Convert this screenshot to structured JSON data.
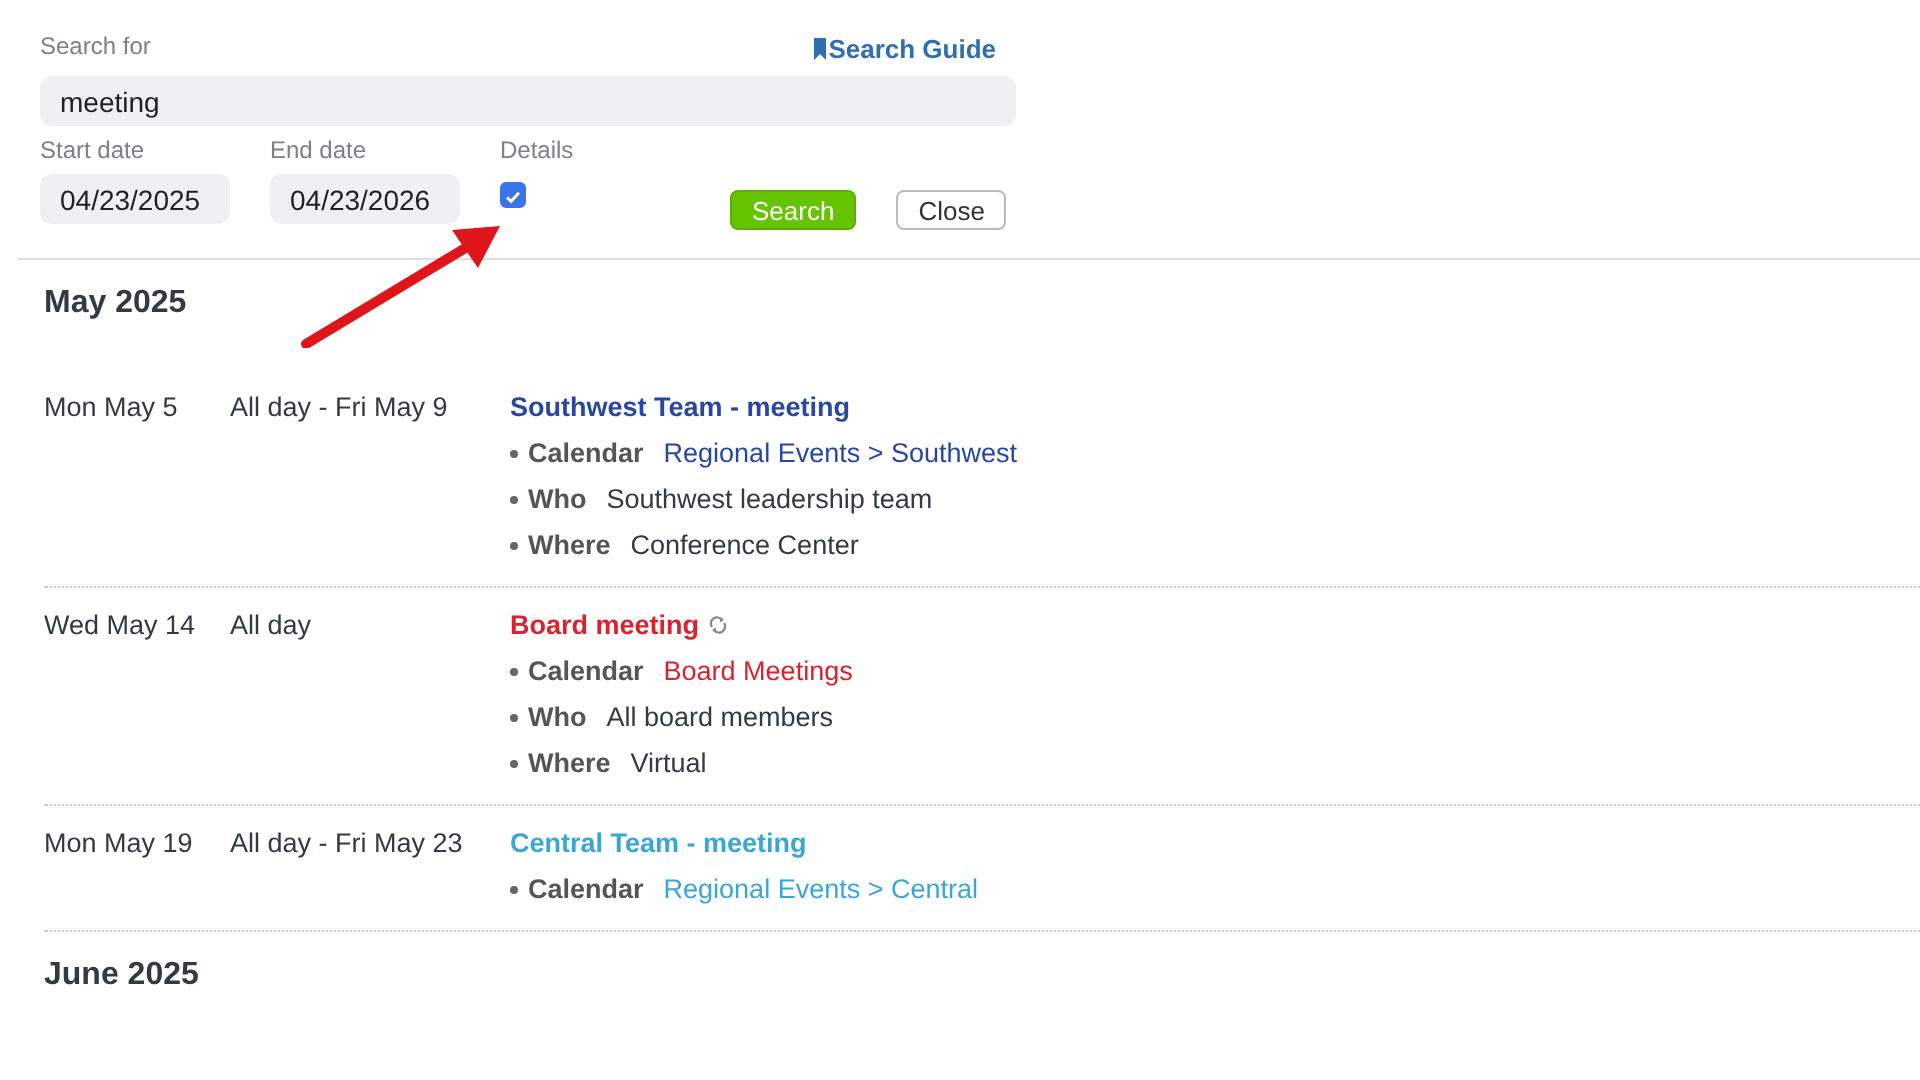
{
  "search": {
    "label": "Search for",
    "value": "meeting",
    "guide_link": "Search Guide"
  },
  "start_date": {
    "label": "Start date",
    "value": "04/23/2025"
  },
  "end_date": {
    "label": "End date",
    "value": "04/23/2026"
  },
  "details": {
    "label": "Details",
    "checked": true
  },
  "buttons": [
    {
      "label": "Search",
      "kind": "primary"
    },
    {
      "label": "Close",
      "kind": "secondary"
    }
  ],
  "annotation": {
    "kind": "arrow"
  },
  "months": [
    {
      "title": "May 2025",
      "events": [
        {
          "date": "Mon May 5",
          "time": "All day - Fri May 9",
          "title": "Southwest Team - meeting",
          "color": "#2a46a3",
          "recurring": false,
          "details": [
            {
              "kind": "link",
              "label": "Calendar",
              "value": "Regional Events > Southwest"
            },
            {
              "kind": "text",
              "label": "Who",
              "value": "Southwest leadership team"
            },
            {
              "kind": "text",
              "label": "Where",
              "value": "Conference Center"
            }
          ]
        },
        {
          "date": "Wed May 14",
          "time": "All day",
          "title": "Board meeting",
          "color": "#d9232e",
          "recurring": true,
          "details": [
            {
              "kind": "link",
              "label": "Calendar",
              "value": "Board Meetings"
            },
            {
              "kind": "text",
              "label": "Who",
              "value": "All board members"
            },
            {
              "kind": "text",
              "label": "Where",
              "value": "Virtual"
            }
          ]
        },
        {
          "date": "Mon May 19",
          "time": "All day - Fri May 23",
          "title": "Central Team - meeting",
          "color": "#3aa6d6",
          "recurring": false,
          "details": [
            {
              "kind": "link",
              "label": "Calendar",
              "value": "Regional Events > Central"
            }
          ]
        }
      ]
    },
    {
      "title": "June 2025"
    }
  ]
}
